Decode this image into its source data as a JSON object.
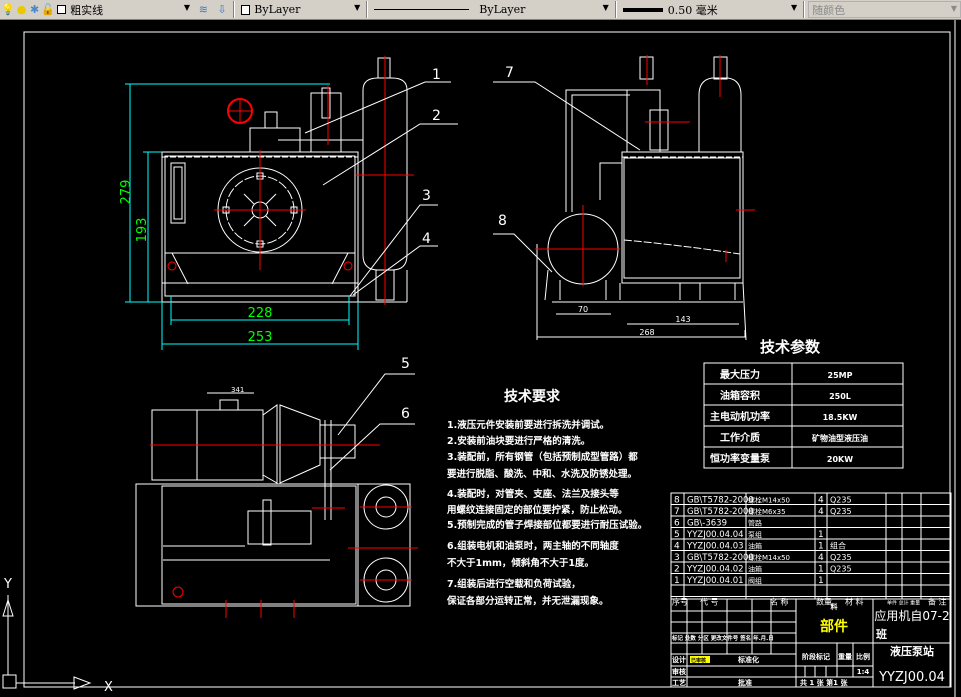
{
  "toolbar": {
    "layer_name": "粗实线",
    "color": "ByLayer",
    "linetype": "ByLayer",
    "lineweight": "0.50 毫米",
    "plotstyle": "随颜色"
  },
  "labels": {
    "l1": "1",
    "l2": "2",
    "l3": "3",
    "l4": "4",
    "l5": "5",
    "l6": "6",
    "l7": "7",
    "l8": "8"
  },
  "dims": {
    "d279": "279",
    "d193": "193",
    "d228": "228",
    "d253": "253",
    "d70": "70",
    "d143": "143",
    "d268": "268",
    "d341": "341"
  },
  "params": {
    "title": "技术参数",
    "rows": [
      [
        "最大压力",
        "25MP"
      ],
      [
        "油箱容积",
        "250L"
      ],
      [
        "主电动机功率",
        "18.5KW"
      ],
      [
        "工作介质",
        "矿物油型液压油"
      ],
      [
        "恒功率变量泵",
        "20KW"
      ]
    ]
  },
  "requirements": {
    "title": "技术要求",
    "lines": [
      "1.液压元件安装前要进行拆洗并调试。",
      "2.安装前油块要进行严格的清洗。",
      "3.装配前，所有钢管（包括预制成型管路）都",
      "要进行脱脂、酸洗、中和、水洗及防锈处理。",
      "4.装配时，对管夹、支座、法兰及接头等",
      "用螺纹连接固定的部位要拧紧，防止松动。",
      "5.预制完成的管子焊接部位都要进行耐压试验。",
      "6.组装电机和油泵时，两主轴的不同轴度",
      "不大于1mm，倾斜角不大于1度。",
      "7.组装后进行空载和负荷试验，",
      "保证各部分运转正常，并无泄漏现象。"
    ]
  },
  "bom": {
    "rows": [
      [
        "8",
        "GB\\T5782-2000",
        "螺栓M14x50",
        "4",
        "Q235"
      ],
      [
        "7",
        "GB\\T5782-2000",
        "螺栓M6x35",
        "4",
        "Q235"
      ],
      [
        "6",
        "GB\\-3639",
        "管路",
        "",
        ""
      ],
      [
        "5",
        "YYZJ00.04.04",
        "泵组",
        "1",
        ""
      ],
      [
        "4",
        "YYZJ00.04.03",
        "油箱",
        "1",
        "组合"
      ],
      [
        "3",
        "GB\\T5782-2000",
        "螺栓M14x50",
        "4",
        "Q235"
      ],
      [
        "2",
        "YYZJ00.04.02",
        "油箱",
        "1",
        "Q235"
      ],
      [
        "1",
        "YYZJ00.04.01",
        "阀组",
        "1",
        ""
      ]
    ],
    "header": [
      "序号",
      "代 号",
      "名 称",
      "数量",
      "材 料",
      "单件 总计 重量",
      "备 注"
    ]
  },
  "title_block": {
    "material_label": "料",
    "part_type": "部件",
    "school": "应用机自07-2",
    "class_label": "班",
    "drawing_name": "液压泵站",
    "drawing_no": "YYZJ00.04",
    "scale": "1:4",
    "stage": "阶段标记",
    "weight": "重量",
    "ratio": "比例",
    "sheets": "共 1 张  第1 张",
    "r1": "标记 处数 分区 更改文件号 签名 年.月.日",
    "designer": "设计",
    "designer_name": "已审核",
    "check": "审核",
    "process": "工艺",
    "std": "标准化",
    "approve": "批准"
  },
  "ucs": {
    "x": "X",
    "y": "Y"
  }
}
